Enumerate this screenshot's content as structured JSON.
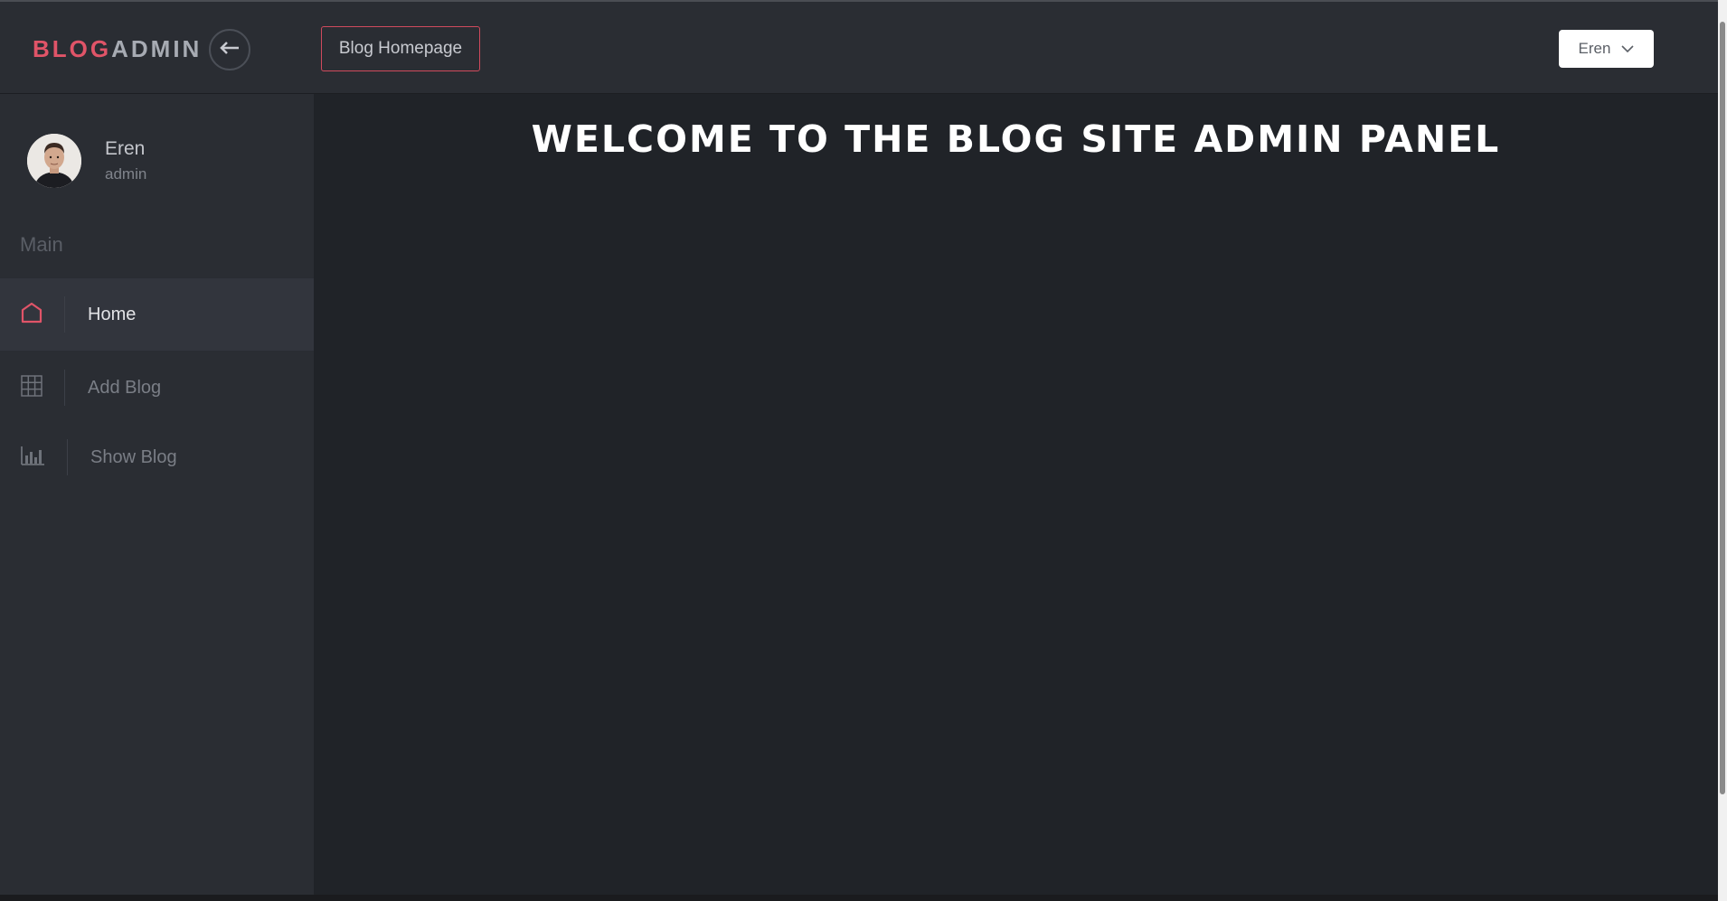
{
  "brand": {
    "part1": "BLOG",
    "part2": "ADMIN"
  },
  "header": {
    "homepage_label": "Blog Homepage",
    "user_dropdown_label": "Eren"
  },
  "profile": {
    "name": "Eren",
    "role": "admin"
  },
  "sidebar": {
    "section_label": "Main",
    "items": [
      {
        "label": "Home",
        "icon": "home-icon",
        "active": true
      },
      {
        "label": "Add Blog",
        "icon": "grid-icon",
        "active": false
      },
      {
        "label": "Show Blog",
        "icon": "bar-chart-icon",
        "active": false
      }
    ]
  },
  "main": {
    "welcome_text": "WELCOME TO THE BLOG SITE ADMIN PANEL"
  },
  "colors": {
    "accent": "#e05468",
    "background": "#202328",
    "panel": "#2a2d33"
  }
}
